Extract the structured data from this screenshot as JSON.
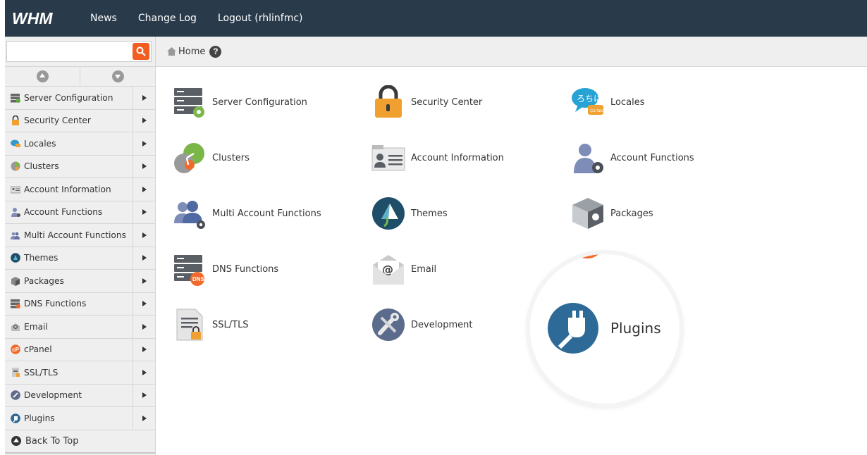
{
  "topbar": {
    "logo_text": "WHM",
    "nav": [
      "News",
      "Change Log",
      "Logout (rhlinfmc)"
    ]
  },
  "search": {
    "placeholder": "",
    "value": ""
  },
  "breadcrumb": {
    "home": "Home",
    "help": "?"
  },
  "sidebar": {
    "items": [
      {
        "label": "Server Configuration",
        "icon": "server-icon"
      },
      {
        "label": "Security Center",
        "icon": "lock-icon"
      },
      {
        "label": "Locales",
        "icon": "locale-bubble-icon"
      },
      {
        "label": "Clusters",
        "icon": "cluster-icon"
      },
      {
        "label": "Account Information",
        "icon": "id-card-icon"
      },
      {
        "label": "Account Functions",
        "icon": "user-gear-icon"
      },
      {
        "label": "Multi Account Functions",
        "icon": "users-gear-icon"
      },
      {
        "label": "Themes",
        "icon": "themes-icon"
      },
      {
        "label": "Packages",
        "icon": "package-icon"
      },
      {
        "label": "DNS Functions",
        "icon": "dns-server-icon"
      },
      {
        "label": "Email",
        "icon": "email-icon"
      },
      {
        "label": "cPanel",
        "icon": "cpanel-icon"
      },
      {
        "label": "SSL/TLS",
        "icon": "certificate-icon"
      },
      {
        "label": "Development",
        "icon": "wrench-icon"
      },
      {
        "label": "Plugins",
        "icon": "plug-icon"
      }
    ],
    "back_to_top": "Back To Top"
  },
  "main": {
    "tiles": [
      {
        "label": "Server Configuration",
        "icon": "server-config-icon"
      },
      {
        "label": "Security Center",
        "icon": "padlock-icon"
      },
      {
        "label": "Locales",
        "icon": "locales-icon"
      },
      {
        "label": "Clusters",
        "icon": "clusters-icon"
      },
      {
        "label": "Account Information",
        "icon": "account-info-icon"
      },
      {
        "label": "Account Functions",
        "icon": "account-functions-icon"
      },
      {
        "label": "Multi Account Functions",
        "icon": "multi-account-icon"
      },
      {
        "label": "Themes",
        "icon": "themes-icon"
      },
      {
        "label": "Packages",
        "icon": "packages-icon"
      },
      {
        "label": "DNS Functions",
        "icon": "dns-functions-icon"
      },
      {
        "label": "Email",
        "icon": "email-icon"
      },
      {
        "label": "SSL/TLS",
        "icon": "ssl-tls-icon"
      },
      {
        "label": "Development",
        "icon": "development-icon"
      }
    ],
    "magnified": {
      "label": "Plugins",
      "icon": "plug-icon"
    }
  },
  "colors": {
    "topbar": "#293a4a",
    "accent": "#f25d22",
    "sidebar_bg": "#efefef",
    "plugin_blue": "#2d6a97"
  }
}
